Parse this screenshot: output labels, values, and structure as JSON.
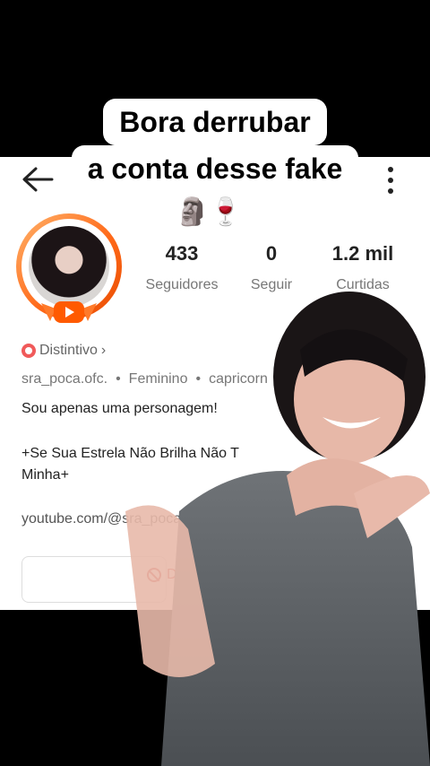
{
  "caption": {
    "line1": "Bora derrubar",
    "line2": "a conta desse fake"
  },
  "header": {
    "back_icon": "arrow-left-icon",
    "more_icon": "vertical-dots-icon",
    "emojis": "🗿🍷"
  },
  "stats": [
    {
      "value": "433",
      "label": "Seguidores"
    },
    {
      "value": "0",
      "label": "Seguir"
    },
    {
      "value": "1.2 mil",
      "label": "Curtidas"
    }
  ],
  "profile": {
    "badge_label": "Distintivo",
    "badge_chevron": "›",
    "username": "sra_poca.ofc.",
    "gender": "Feminino",
    "sign": "capricorn",
    "bio_line1": "Sou apenas uma personagem!",
    "bio_line2": "+Se Sua Estrela Não Brilha Não T",
    "bio_line3": "Minha+",
    "link": "youtube.com/@sra_poca"
  },
  "actions": {
    "block_label": "De"
  },
  "colors": {
    "avatar_ring": "#ff6a1a",
    "badge": "#f05a5a",
    "block": "#cc3333"
  }
}
